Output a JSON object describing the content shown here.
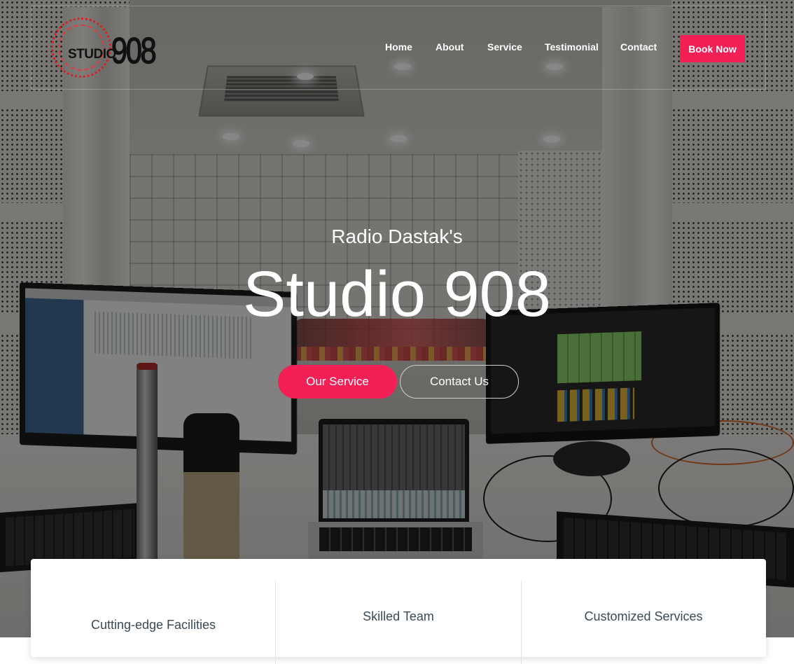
{
  "brand": {
    "logo_word": "STUDIO",
    "logo_number": "908",
    "accent_color": "#f41f55",
    "logo_ring_color": "#d82024"
  },
  "nav": {
    "items": [
      {
        "label": "Home"
      },
      {
        "label": "About"
      },
      {
        "label": "Service"
      },
      {
        "label": "Testimonial"
      },
      {
        "label": "Contact"
      }
    ],
    "cta_label": "Book Now"
  },
  "hero": {
    "subtitle": "Radio Dastak's",
    "title": "Studio 908",
    "primary_button": "Our Service",
    "secondary_button": "Contact Us"
  },
  "features": [
    {
      "label": "Cutting-edge Facilities"
    },
    {
      "label": "Skilled Team"
    },
    {
      "label": "Customized Services"
    }
  ]
}
